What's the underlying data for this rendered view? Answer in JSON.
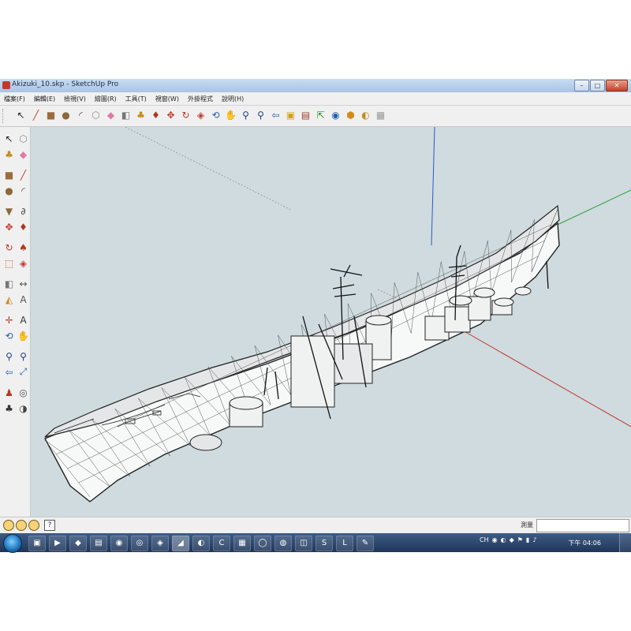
{
  "window": {
    "title": "Akizuki_10.skp - SketchUp Pro",
    "minimize": "–",
    "maximize": "□",
    "close": "✕"
  },
  "menu": [
    "檔案(F)",
    "編輯(E)",
    "檢視(V)",
    "繪圖(R)",
    "工具(T)",
    "視窗(W)",
    "外掛程式",
    "說明(H)"
  ],
  "toolbar": {
    "tools": [
      {
        "name": "select-tool",
        "glyph": "↖",
        "color": "#222222"
      },
      {
        "name": "line-tool",
        "glyph": "╱",
        "color": "#c0392b"
      },
      {
        "name": "rectangle-tool",
        "glyph": "■",
        "color": "#9c6b3d"
      },
      {
        "name": "circle-tool",
        "glyph": "●",
        "color": "#8a6a3a"
      },
      {
        "name": "arc-tool",
        "glyph": "◜",
        "color": "#444444"
      },
      {
        "name": "make-component-tool",
        "glyph": "⬡",
        "color": "#8a8a8a"
      },
      {
        "name": "eraser-tool",
        "glyph": "◆",
        "color": "#e07aa4"
      },
      {
        "name": "tape-measure-tool",
        "glyph": "◧",
        "color": "#777777"
      },
      {
        "name": "paint-bucket-tool",
        "glyph": "♣",
        "color": "#c58b1c"
      },
      {
        "name": "push-pull-tool",
        "glyph": "♦",
        "color": "#b0381f"
      },
      {
        "name": "move-tool",
        "glyph": "✥",
        "color": "#c0392b"
      },
      {
        "name": "rotate-tool",
        "glyph": "↻",
        "color": "#c0392b"
      },
      {
        "name": "offset-tool",
        "glyph": "◈",
        "color": "#c0392b"
      },
      {
        "name": "orbit-tool",
        "glyph": "⟲",
        "color": "#1f5fb0"
      },
      {
        "name": "pan-tool",
        "glyph": "✋",
        "color": "#7a7a7a"
      },
      {
        "name": "zoom-tool",
        "glyph": "⚲",
        "color": "#1f3f80"
      },
      {
        "name": "zoom-extents-tool",
        "glyph": "⚲",
        "color": "#1f3f80"
      },
      {
        "name": "previous-view-tool",
        "glyph": "⇦",
        "color": "#1f5fb0"
      },
      {
        "name": "warehouse-tool",
        "glyph": "▣",
        "color": "#d4a017"
      },
      {
        "name": "components-tool",
        "glyph": "▤",
        "color": "#a0412b"
      },
      {
        "name": "share-model-tool",
        "glyph": "⇱",
        "color": "#2e8b2e"
      },
      {
        "name": "google-earth-tool",
        "glyph": "◉",
        "color": "#1f5fb0"
      },
      {
        "name": "extension-warehouse-tool",
        "glyph": "⬢",
        "color": "#d48a17"
      },
      {
        "name": "layout-tool",
        "glyph": "◐",
        "color": "#c58b1c"
      },
      {
        "name": "style-builder-tool",
        "glyph": "▦",
        "color": "#999999"
      }
    ]
  },
  "left_toolbar": {
    "tools": [
      {
        "name": "select-tool",
        "glyph": "↖",
        "color": "#222222"
      },
      {
        "name": "make-component-tool",
        "glyph": "⬡",
        "color": "#8a8a8a"
      },
      {
        "name": "paint-bucket-tool",
        "glyph": "♣",
        "color": "#c58b1c"
      },
      {
        "name": "eraser-tool",
        "glyph": "◆",
        "color": "#e07aa4"
      },
      {
        "name": "rectangle-tool",
        "glyph": "■",
        "color": "#9c6b3d"
      },
      {
        "name": "line-tool",
        "glyph": "╱",
        "color": "#c0392b"
      },
      {
        "name": "circle-tool",
        "glyph": "●",
        "color": "#8a6a3a"
      },
      {
        "name": "arc-tool",
        "glyph": "◜",
        "color": "#444444"
      },
      {
        "name": "polygon-tool",
        "glyph": "▼",
        "color": "#8a6a3a"
      },
      {
        "name": "freehand-tool",
        "glyph": "∂",
        "color": "#444444"
      },
      {
        "name": "move-tool",
        "glyph": "✥",
        "color": "#c0392b"
      },
      {
        "name": "push-pull-tool",
        "glyph": "♦",
        "color": "#b0381f"
      },
      {
        "name": "rotate-tool",
        "glyph": "↻",
        "color": "#c0392b"
      },
      {
        "name": "follow-me-tool",
        "glyph": "♠",
        "color": "#b0381f"
      },
      {
        "name": "scale-tool",
        "glyph": "⬚",
        "color": "#c0392b"
      },
      {
        "name": "offset-tool",
        "glyph": "◈",
        "color": "#c0392b"
      },
      {
        "name": "tape-measure-tool",
        "glyph": "◧",
        "color": "#777777"
      },
      {
        "name": "dimension-tool",
        "glyph": "↔",
        "color": "#555555"
      },
      {
        "name": "protractor-tool",
        "glyph": "◭",
        "color": "#c58b1c"
      },
      {
        "name": "text-tool",
        "glyph": "A",
        "color": "#555555"
      },
      {
        "name": "axes-tool",
        "glyph": "✛",
        "color": "#c0392b"
      },
      {
        "name": "3d-text-tool",
        "glyph": "A",
        "color": "#333333"
      },
      {
        "name": "orbit-tool",
        "glyph": "⟲",
        "color": "#1f5fb0"
      },
      {
        "name": "pan-tool",
        "glyph": "✋",
        "color": "#7a7a7a"
      },
      {
        "name": "zoom-tool",
        "glyph": "⚲",
        "color": "#1f3f80"
      },
      {
        "name": "zoom-window-tool",
        "glyph": "⚲",
        "color": "#1f3f80"
      },
      {
        "name": "previous-view-tool",
        "glyph": "⇦",
        "color": "#1f5fb0"
      },
      {
        "name": "zoom-extents-tool",
        "glyph": "⤢",
        "color": "#1f5fb0"
      },
      {
        "name": "position-camera-tool",
        "glyph": "♟",
        "color": "#b0381f"
      },
      {
        "name": "look-around-tool",
        "glyph": "◎",
        "color": "#555555"
      },
      {
        "name": "walk-tool",
        "glyph": "♣",
        "color": "#333333"
      },
      {
        "name": "section-plane-tool",
        "glyph": "◑",
        "color": "#444444"
      }
    ]
  },
  "viewport": {
    "background": "#cfdbdf",
    "axis_red": "#c0392b",
    "axis_green": "#2e9e3a",
    "axis_blue": "#2f57c8"
  },
  "status": {
    "help_glyph": "?",
    "measurements_label": "測量",
    "measurements_value": ""
  },
  "taskbar": {
    "clock": "下午 04:06",
    "tray_language": "CH",
    "apps": [
      {
        "name": "explorer",
        "glyph": "▣"
      },
      {
        "name": "media-player",
        "glyph": "▶"
      },
      {
        "name": "app-3",
        "glyph": "◆"
      },
      {
        "name": "app-4",
        "glyph": "▤"
      },
      {
        "name": "app-5",
        "glyph": "◉"
      },
      {
        "name": "app-6",
        "glyph": "◎"
      },
      {
        "name": "app-7",
        "glyph": "◈"
      },
      {
        "name": "sketchup",
        "glyph": "◢",
        "active": true
      },
      {
        "name": "app-9",
        "glyph": "◐"
      },
      {
        "name": "app-10",
        "glyph": "C"
      },
      {
        "name": "app-11",
        "glyph": "▦"
      },
      {
        "name": "app-12",
        "glyph": "◯"
      },
      {
        "name": "app-13",
        "glyph": "◍"
      },
      {
        "name": "app-14",
        "glyph": "◫"
      },
      {
        "name": "skype",
        "glyph": "S"
      },
      {
        "name": "line",
        "glyph": "L"
      },
      {
        "name": "app-17",
        "glyph": "✎"
      }
    ]
  }
}
